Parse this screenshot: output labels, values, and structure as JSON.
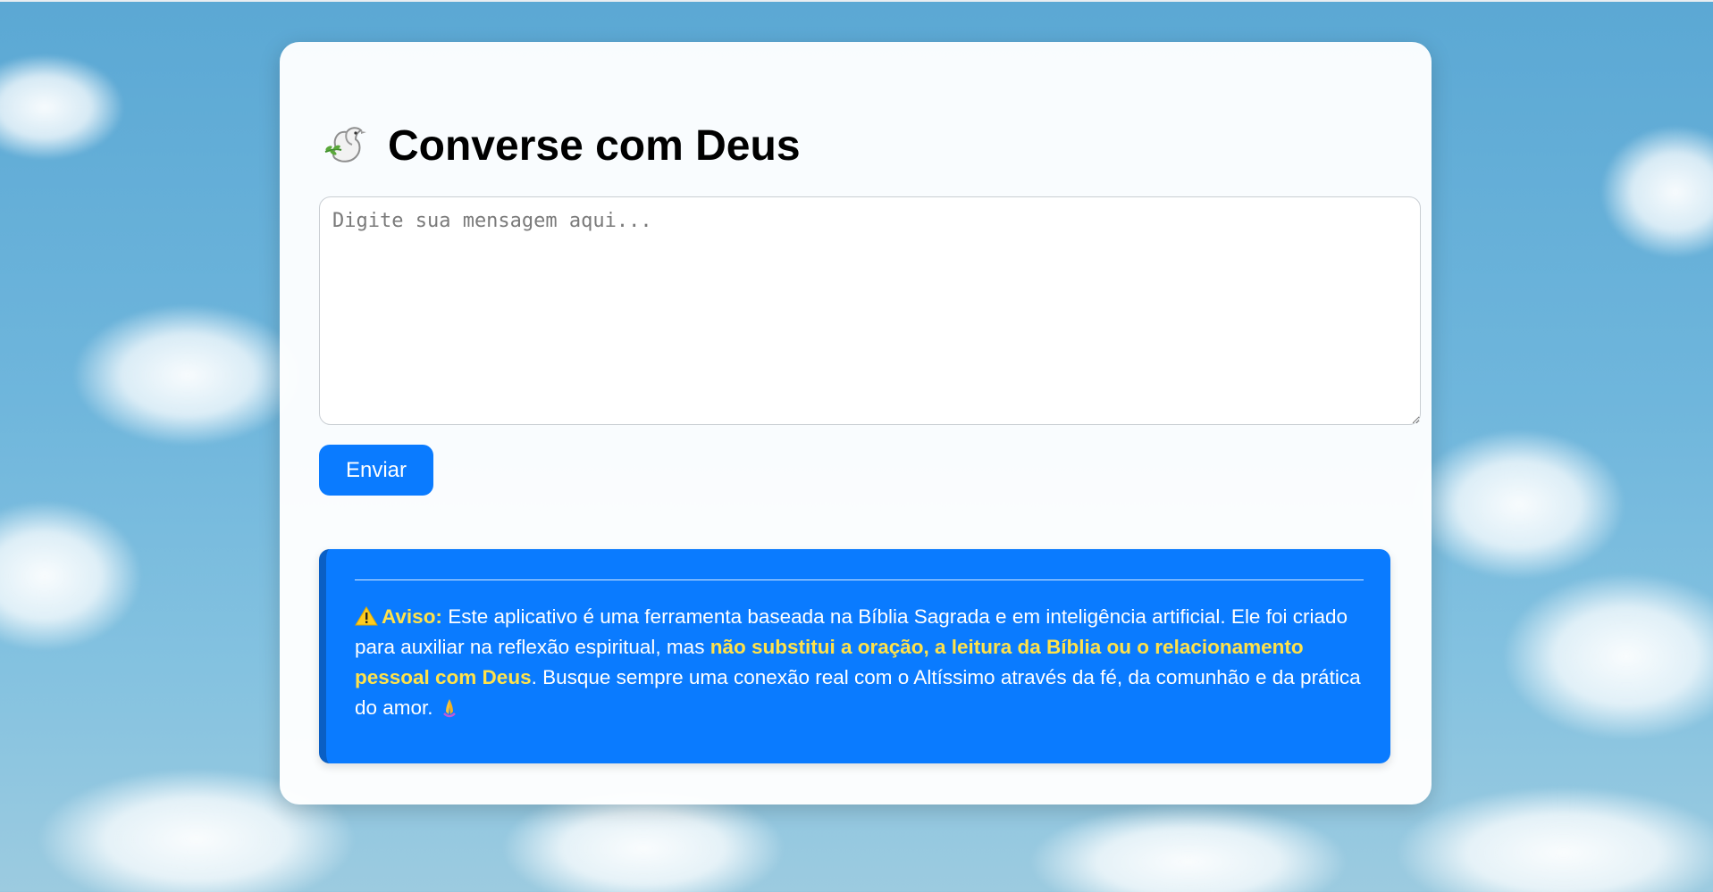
{
  "header": {
    "icon": "dove-icon",
    "title": "Converse com Deus"
  },
  "form": {
    "message_placeholder": "Digite sua mensagem aqui...",
    "message_value": "",
    "send_label": "Enviar"
  },
  "notice": {
    "warning_icon": "warning-icon",
    "label": "Aviso:",
    "text_1": " Este aplicativo é uma ferramenta baseada na Bíblia Sagrada e em inteligência artificial. Ele foi criado para auxiliar na reflexão espiritual, mas ",
    "highlight": "não substitui a oração, a leitura da Bíblia ou o relacionamento pessoal com Deus",
    "text_2": ". Busque sempre uma conexão real com o Altíssimo através da fé, da comunhão e da prática do amor.",
    "closing_icon": "praying-hands-icon"
  },
  "colors": {
    "primary": "#0a7bff",
    "notice_border": "#0a5fc4",
    "highlight": "#ffe24a",
    "sky": "#6fb6dc"
  }
}
